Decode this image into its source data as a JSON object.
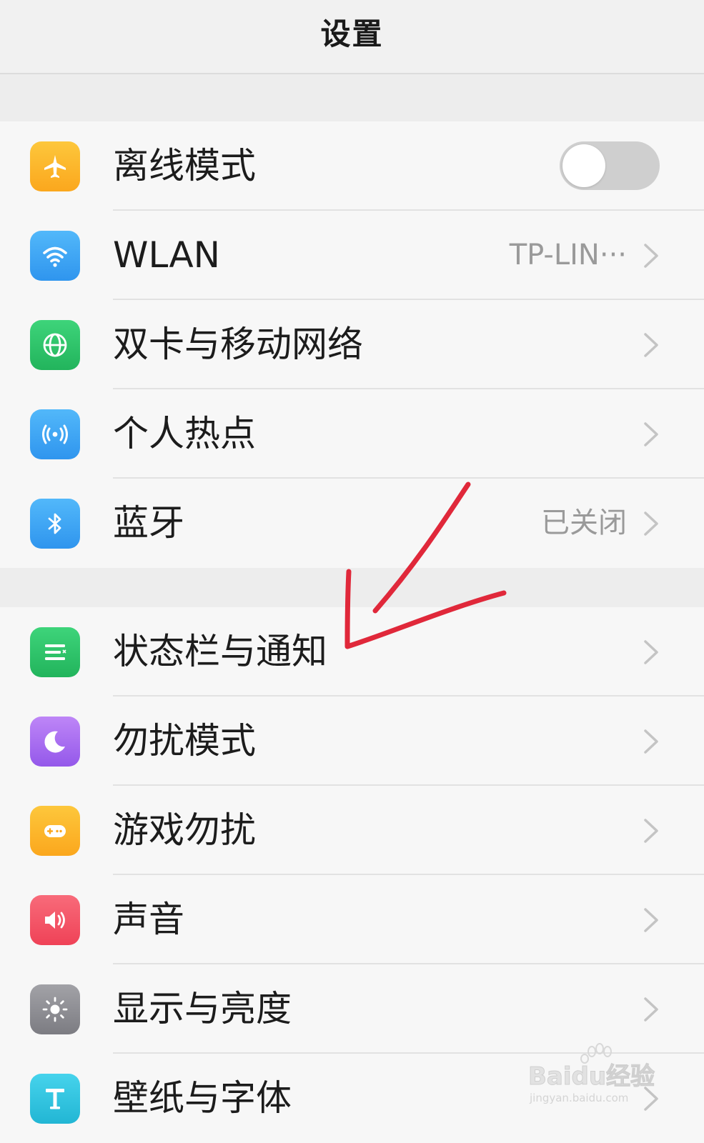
{
  "header": {
    "title": "设置"
  },
  "groups": [
    {
      "items": [
        {
          "label": "离线模式",
          "icon": "airplane-icon",
          "icon_color": "#FCB52A",
          "toggle": false
        },
        {
          "label": "WLAN",
          "value": "TP-LIN···",
          "icon": "wifi-icon",
          "icon_color": "#3FA8F4"
        },
        {
          "label": "双卡与移动网络",
          "icon": "globe-icon",
          "icon_color": "#2FC66A"
        },
        {
          "label": "个人热点",
          "icon": "hotspot-icon",
          "icon_color": "#3FA8F4"
        },
        {
          "label": "蓝牙",
          "value": "已关闭",
          "icon": "bluetooth-icon",
          "icon_color": "#3FA8F4"
        }
      ]
    },
    {
      "items": [
        {
          "label": "状态栏与通知",
          "icon": "notification-bar-icon",
          "icon_color": "#2FC66A"
        },
        {
          "label": "勿扰模式",
          "icon": "moon-icon",
          "icon_color": "#A96BF0"
        },
        {
          "label": "游戏勿扰",
          "icon": "gamepad-icon",
          "icon_color": "#FCB52A"
        },
        {
          "label": "声音",
          "icon": "speaker-icon",
          "icon_color": "#F45667"
        },
        {
          "label": "显示与亮度",
          "icon": "brightness-icon",
          "icon_color": "#8E8E93"
        },
        {
          "label": "壁纸与字体",
          "icon": "font-icon",
          "icon_color": "#32C6E0"
        }
      ]
    }
  ],
  "annotation": {
    "arrow_color": "#E0283A"
  },
  "watermark": {
    "text": "Baidu经验",
    "subtext": "jingyan.baidu.com"
  }
}
